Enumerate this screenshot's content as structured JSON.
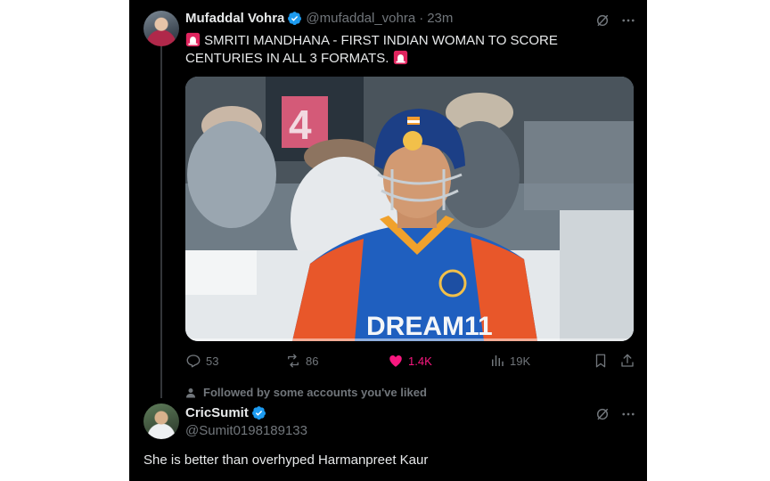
{
  "tweet": {
    "author_name": "Mufaddal Vohra",
    "author_handle": "@mufaddal_vohra",
    "separator": "·",
    "time": "23m",
    "text": "SMRITI MANDHANA - FIRST INDIAN WOMAN TO SCORE CENTURIES IN ALL 3 FORMATS.",
    "media": {
      "jersey_text": "DREAM11",
      "crowd_number": "4"
    },
    "actions": {
      "replies": "53",
      "reposts": "86",
      "likes": "1.4K",
      "views": "19K"
    }
  },
  "followed_note": "Followed by some accounts you've liked",
  "reply": {
    "author_name": "CricSumit",
    "author_handle": "@Sumit0198189133",
    "text": "She is better than overhyped Harmanpreet Kaur"
  },
  "colors": {
    "background": "#000000",
    "text_primary": "#e7e9ea",
    "text_secondary": "#71767b",
    "verified_blue": "#1d9bf0",
    "like_pink": "#f91880",
    "siren_red": "#e0245e"
  },
  "icons": [
    "verified-badge-icon",
    "grok-icon",
    "more-icon",
    "siren-icon",
    "reply-icon",
    "repost-icon",
    "like-icon",
    "views-icon",
    "bookmark-icon",
    "share-icon",
    "person-icon"
  ]
}
